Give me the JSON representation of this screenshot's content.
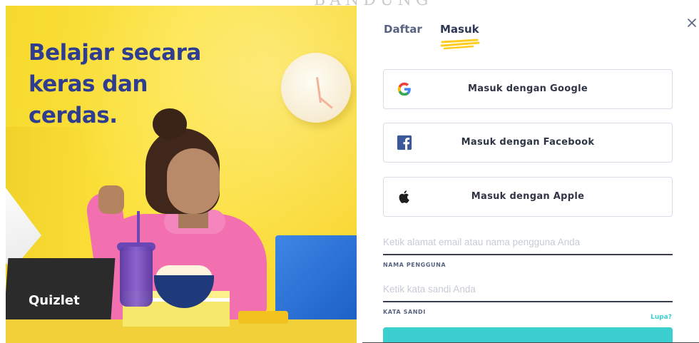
{
  "backdrop": {
    "text": "BANDUNG"
  },
  "hero": {
    "title": "Belajar secara keras dan cerdas.",
    "logo": "Quizlet"
  },
  "auth": {
    "tabs": [
      {
        "label": "Daftar",
        "active": false
      },
      {
        "label": "Masuk",
        "active": true
      }
    ],
    "close_icon": "close-icon",
    "social": [
      {
        "label": "Masuk dengan Google",
        "icon": "google-icon"
      },
      {
        "label": "Masuk dengan Facebook",
        "icon": "facebook-icon"
      },
      {
        "label": "Masuk dengan Apple",
        "icon": "apple-icon"
      }
    ],
    "username": {
      "placeholder": "Ketik alamat email atau nama pengguna Anda",
      "value": "",
      "label": "NAMA PENGGUNA"
    },
    "password": {
      "placeholder": "Ketik kata sandi Anda",
      "value": "",
      "label": "KATA SANDI"
    },
    "forgot_label": "Lupa?"
  },
  "colors": {
    "accent": "#3ccfcf",
    "brand_navy": "#2e3d8f",
    "hero_yellow": "#fde23c",
    "tab_underline": "#ffcd1f"
  }
}
